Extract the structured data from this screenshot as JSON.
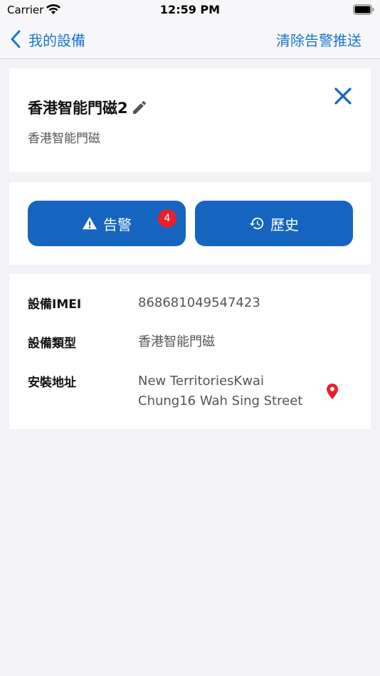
{
  "status_bar": {
    "carrier": "Carrier",
    "time": "12:59 PM",
    "wifi_icon": "wifi-icon",
    "battery_icon": "battery-icon"
  },
  "nav": {
    "back_label": "我的設備",
    "right_action": "清除告警推送",
    "back_icon": "chevron-left-icon",
    "accent_color": "#1976d2"
  },
  "device": {
    "name": "香港智能門磁2",
    "type_label": "香港智能門磁",
    "edit_icon": "pencil-icon",
    "close_icon": "close-icon"
  },
  "actions": {
    "alarm_label": "告警",
    "alarm_badge": "4",
    "alarm_icon": "warning-icon",
    "history_label": "歷史",
    "history_icon": "history-icon",
    "button_color": "#1565c0",
    "badge_color": "#e8202a"
  },
  "info": {
    "rows": [
      {
        "label": "設備IMEI",
        "value": "868681049547423"
      },
      {
        "label": "設備類型",
        "value": "香港智能門磁"
      },
      {
        "label": "安裝地址",
        "value": "New TerritoriesKwai Chung16 Wah Sing Street"
      }
    ],
    "location_icon": "map-pin-icon"
  }
}
